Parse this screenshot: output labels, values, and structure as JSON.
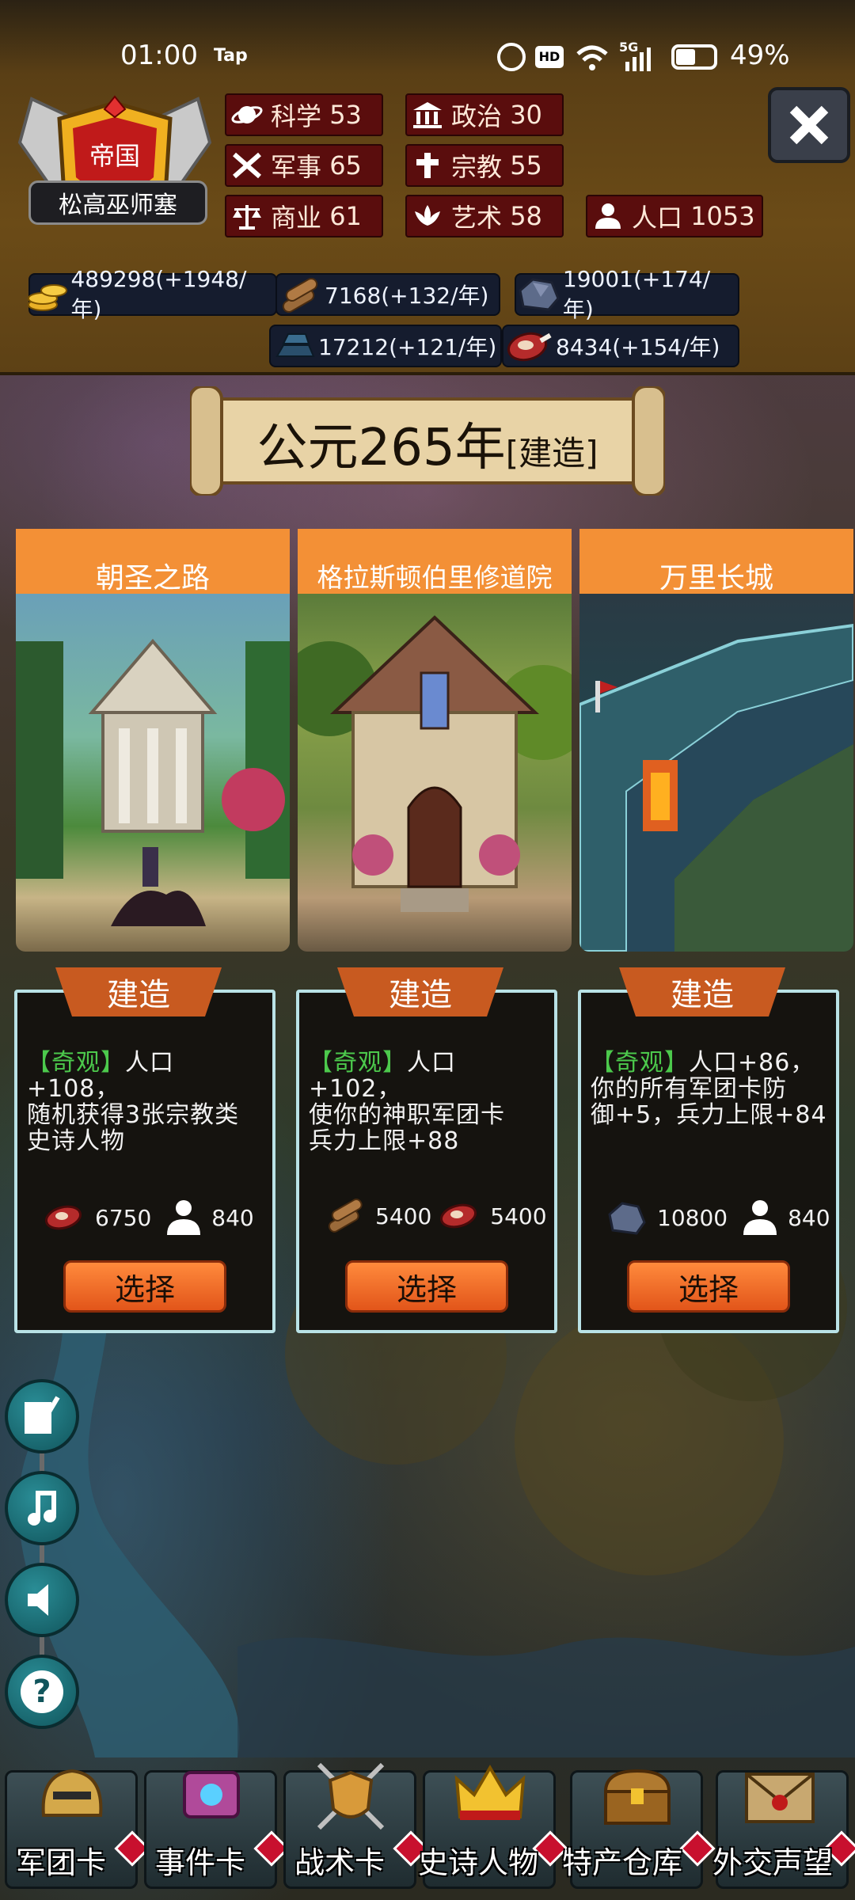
{
  "status_bar": {
    "time": "01:00",
    "app": "Tap",
    "network": "5G",
    "battery": "49%"
  },
  "empire": {
    "type": "帝国",
    "name": "松高巫师塞"
  },
  "stats": [
    {
      "label": "科学",
      "value": "53",
      "icon": "planet-icon"
    },
    {
      "label": "政治",
      "value": "30",
      "icon": "government-building-icon"
    },
    {
      "label": "军事",
      "value": "65",
      "icon": "crossed-swords-icon"
    },
    {
      "label": "宗教",
      "value": "55",
      "icon": "cross-icon"
    },
    {
      "label": "商业",
      "value": "61",
      "icon": "scales-icon"
    },
    {
      "label": "艺术",
      "value": "58",
      "icon": "lotus-icon"
    },
    {
      "label": "人口",
      "value": "1053",
      "icon": "person-icon"
    }
  ],
  "resources": [
    {
      "name": "gold",
      "text": "489298(+1948/年)",
      "icon": "gold-coins-icon"
    },
    {
      "name": "wood",
      "text": "7168(+132/年)",
      "icon": "logs-icon"
    },
    {
      "name": "stone",
      "text": "19001(+174/年)",
      "icon": "stone-icon"
    },
    {
      "name": "iron",
      "text": "17212(+121/年)",
      "icon": "iron-ingot-icon"
    },
    {
      "name": "meat",
      "text": "8434(+154/年)",
      "icon": "meat-icon"
    }
  ],
  "banner": {
    "year": "公元265年",
    "mode": "[建造]"
  },
  "cards": [
    {
      "title": "朝圣之路",
      "build": "建造",
      "tag": "【奇观】",
      "desc_first": "人口+108，",
      "desc_rest": [
        "随机获得3张宗教类",
        "史诗人物"
      ],
      "costs": [
        {
          "icon": "meat-icon",
          "value": "6750"
        },
        {
          "icon": "person-icon",
          "value": "840"
        }
      ],
      "select": "选择"
    },
    {
      "title": "格拉斯顿伯里修道院",
      "build": "建造",
      "tag": "【奇观】",
      "desc_first": "人口+102，",
      "desc_rest": [
        "使你的神职军团卡",
        "兵力上限+88"
      ],
      "costs": [
        {
          "icon": "logs-icon",
          "value": "5400"
        },
        {
          "icon": "meat-icon",
          "value": "5400"
        }
      ],
      "select": "选择"
    },
    {
      "title": "万里长城",
      "build": "建造",
      "tag": "【奇观】",
      "desc_first": "人口+86，",
      "desc_rest": [
        "你的所有军团卡防",
        "御+5，兵力上限+84"
      ],
      "costs": [
        {
          "icon": "stone-icon",
          "value": "10800"
        },
        {
          "icon": "person-icon",
          "value": "840"
        }
      ],
      "select": "选择"
    }
  ],
  "side_buttons": [
    "book-quill-icon",
    "music-note-icon",
    "speaker-icon",
    "help-icon"
  ],
  "nav": [
    {
      "label": "军团卡",
      "icon": "helmet-icon"
    },
    {
      "label": "事件卡",
      "icon": "scroll-icon"
    },
    {
      "label": "战术卡",
      "icon": "shield-swords-icon"
    },
    {
      "label": "史诗人物",
      "icon": "crown-icon"
    },
    {
      "label": "特产仓库",
      "icon": "treasure-chest-icon"
    },
    {
      "label": "外交声望",
      "icon": "envelope-icon"
    }
  ],
  "colors": {
    "tag_green": "#4cc94c",
    "card_header": "#f39036",
    "select_button": "#f26a24",
    "stat_bg": "#5a0d0d"
  }
}
